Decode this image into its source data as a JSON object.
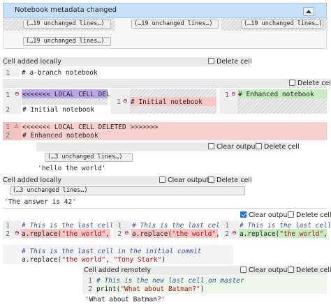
{
  "meta": {
    "title": "Notebook metadata changed",
    "collapse_icon": "caret-up-icon",
    "unchanged_a": "(…19 unchanged lines…)",
    "unchanged_b": "(…19 unchanged lines…)",
    "unchanged_c": "(…19 unchanged lines…)",
    "unchanged_d": "(…19 unchanged lines…)"
  },
  "cell1": {
    "header": "Cell added locally",
    "delete_label": "Delete cell",
    "line_nums": [
      "1"
    ],
    "code": "# a-branch notebook"
  },
  "cell2": {
    "delete_label": "Delete cell",
    "left_lines": [
      "<<<<<<< LOCAL CELL DELETE",
      "# Initial notebook"
    ],
    "left_nums": [
      "1",
      "2"
    ],
    "mid_lines": [
      "# Initial notebook"
    ],
    "mid_nums": [
      "1"
    ],
    "right_lines": [
      "# Enhanced notebook"
    ],
    "right_nums": [
      "1"
    ],
    "merged_nums": [
      "1",
      "2"
    ],
    "merged_lines": [
      "<<<<<<< LOCAL CELL DELETED >>>>>>>",
      "# Enhanced notebook"
    ],
    "clear_outputs_label": "Clear outputs",
    "delete_label2": "Delete cell",
    "unchanged": "(…3 unchanged lines…)",
    "output": "'hello the world'"
  },
  "cell3": {
    "header": "Cell added locally",
    "clear_outputs_label": "Clear outputs",
    "delete_label": "Delete cell",
    "unchanged": "(…3 unchanged lines…)",
    "output": "'The answer is 42'"
  },
  "cell4": {
    "clear_outputs_label": "Clear outputs",
    "delete_label": "Delete cell",
    "nums": [
      "1",
      "2"
    ],
    "comment": "# This is the last cell",
    "code_prefix": "a.replace(",
    "str1": "\"the world\"",
    "sep": ", ",
    "merged_comment": "# This is the last cell in the initial commit",
    "merged_str2": "\"Tony Stark\"",
    "merged_suffix": ")"
  },
  "cell5": {
    "header": "Cell added remotely",
    "clear_outputs_label": "Clear outputs",
    "delete_label": "Delete cell",
    "nums": [
      "1",
      "2"
    ],
    "line1": "# This is the new last cell on master",
    "line2_fn": "print(",
    "line2_str": "\"What about Batman?\"",
    "line2_end": ")",
    "output": "'What about Batman?'"
  }
}
